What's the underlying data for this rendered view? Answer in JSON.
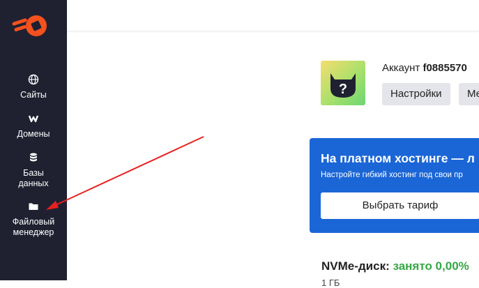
{
  "sidebar": {
    "items": [
      {
        "label": "Сайты",
        "icon": "globe-icon"
      },
      {
        "label": "Домены",
        "icon": "domain-w-icon"
      },
      {
        "label": "Базы данных",
        "icon": "database-icon"
      },
      {
        "label": "Файловый менеджер",
        "icon": "folder-icon"
      }
    ]
  },
  "account": {
    "prefix": "Аккаунт ",
    "id": "f0885570",
    "settings_label": "Настройки",
    "second_button_label": "Ме"
  },
  "promo": {
    "title": "На платном хостинге — л",
    "subtitle": "Настройте гибкий хостинг под свои пр",
    "button_label": "Выбрать тариф"
  },
  "disk": {
    "label": "NVMe-диск: ",
    "used": "занято 0,00%",
    "sub": "1 ГБ"
  },
  "colors": {
    "sidebar_bg": "#1f2131",
    "logo": "#f4511e",
    "promo_bg": "#1a66d6",
    "used_green": "#35a845",
    "arrow": "#e8201e"
  }
}
